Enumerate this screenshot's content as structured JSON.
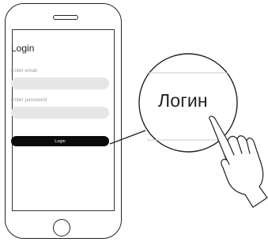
{
  "login_screen": {
    "title": "Login",
    "email_label": "Enter email",
    "password_label": "Enter password",
    "login_button": "Login"
  },
  "magnifier": {
    "text": "Логин"
  }
}
